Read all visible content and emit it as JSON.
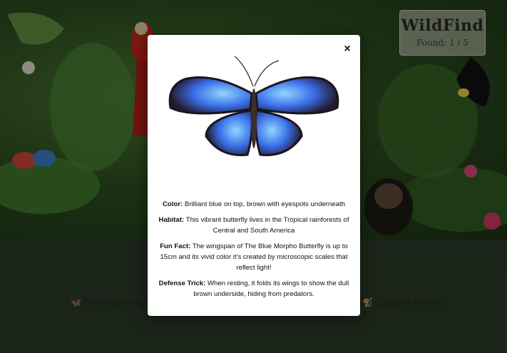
{
  "logo": {
    "title": "WildFind",
    "found": "Found: 1 / 5"
  },
  "find_list": {
    "items": [
      {
        "icon": "butterfly-icon",
        "label": "Blue Morpho Butterfly"
      },
      {
        "icon": "monkey-icon",
        "label": "Capuchin Monkey"
      }
    ]
  },
  "modal": {
    "close_label": "×",
    "image_alt_icon": "blue-morpho-butterfly-image",
    "facts": [
      {
        "label": "Color:",
        "text": "Brilliant blue on top, brown with eyespots underneath"
      },
      {
        "label": "Habitat:",
        "text": "This vibrant butterfly lives in the Tropical rainforests of Central and South America"
      },
      {
        "label": "Fun Fact:",
        "text": "The wingspan of The Blue Morpho Butterfly is up to 15cm and its vivid color it's created by microscopic scales that reflect light!"
      },
      {
        "label": "Defense Trick:",
        "text": "When resting, it folds its wings to show the dull brown underside, hiding from predators."
      }
    ]
  },
  "colors": {
    "accent": "#3c6ee8",
    "jungle": "#2e5021",
    "modal_bg": "#ffffff"
  }
}
